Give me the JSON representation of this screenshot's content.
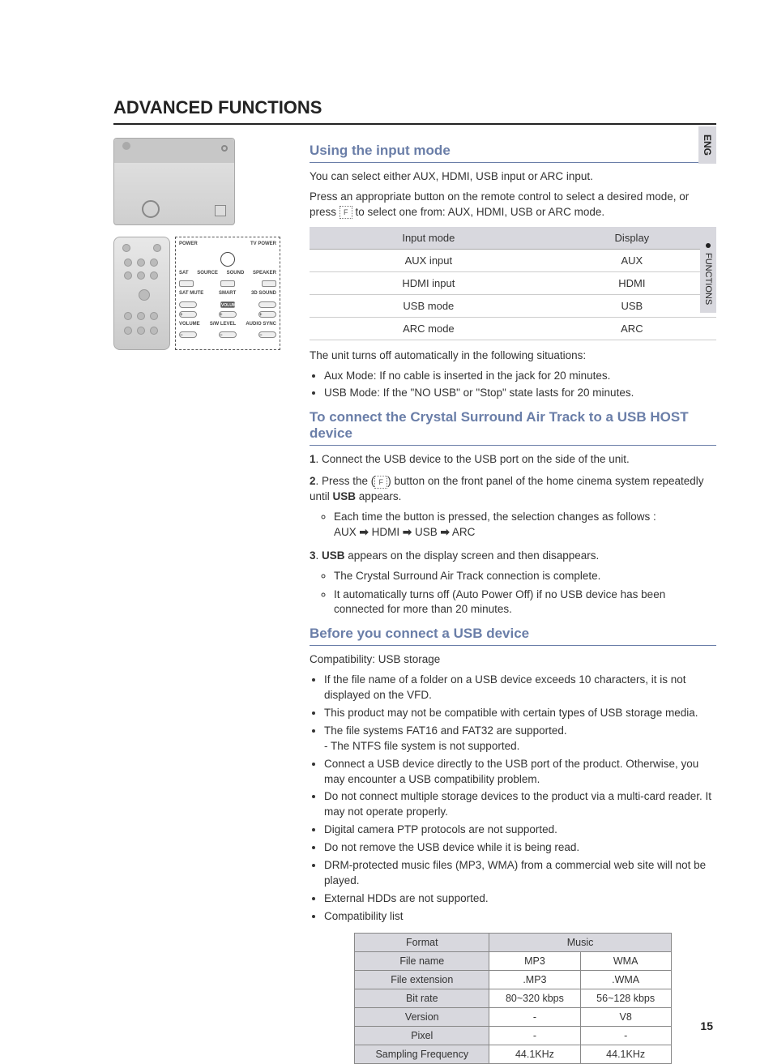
{
  "page": {
    "main_title": "ADVANCED FUNCTIONS",
    "lang_tab": "ENG",
    "section_tab": "FUNCTIONS",
    "page_number": "15"
  },
  "remote_labels": {
    "power": "POWER",
    "tvpower": "TV POWER",
    "sat": "SAT",
    "source": "SOURCE",
    "sound": "SOUND",
    "speaker": "SPEAKER",
    "satmute": "SAT MUTE",
    "smart": "SMART",
    "volume_center": "VOLUME",
    "sound3d": "3D SOUND",
    "volume": "VOLUME",
    "swlevel": "S/W LEVEL",
    "audiosync": "AUDIO SYNC"
  },
  "input_mode": {
    "heading": "Using the input mode",
    "para1": "You can select either AUX, HDMI, USB input or ARC input.",
    "para2a": "Press an appropriate button on the remote control to select a desired mode, or press ",
    "para2b": " to select one from: AUX, HDMI, USB or ARC mode.",
    "table": {
      "head": [
        "Input mode",
        "Display"
      ],
      "rows": [
        [
          "AUX input",
          "AUX"
        ],
        [
          "HDMI input",
          "HDMI"
        ],
        [
          "USB mode",
          "USB"
        ],
        [
          "ARC mode",
          "ARC"
        ]
      ]
    },
    "after1": "The unit turns off automatically in the following situations:",
    "bullets": [
      "Aux Mode: If no cable is inserted in the jack for 20 minutes.",
      "USB Mode: If the \"NO USB\" or \"Stop\" state lasts for 20 minutes."
    ]
  },
  "usb_host": {
    "heading": "To connect the Crystal Surround Air Track to a USB HOST device",
    "step1_num": "1",
    "step1": ". Connect the USB device to the USB port on the side of the unit.",
    "step2_num": "2",
    "step2a": ". Press the (",
    "step2b": ") button on the front panel of the home cinema system repeatedly until ",
    "step2c_bold": "USB",
    "step2d": " appears.",
    "step2_sub": "Each time the button is pressed, the selection changes as follows :",
    "step2_chain": [
      "AUX",
      "HDMI",
      "USB",
      "ARC"
    ],
    "step3_num": "3",
    "step3a_bold": "USB",
    "step3b": " appears on the display screen and then disappears.",
    "step3_subs": [
      "The Crystal Surround Air Track connection is complete.",
      "It automatically turns off (Auto Power Off) if no USB device has been connected for more than 20 minutes."
    ]
  },
  "before_usb": {
    "heading": "Before you connect a USB device",
    "intro": "Compatibility: USB storage",
    "bullets": [
      "If the file name of a folder on a USB device exceeds 10 characters, it is not displayed on the VFD.",
      "This product may not be compatible with certain types of USB storage media.",
      "The file systems FAT16 and FAT32 are supported.",
      "Connect a USB device directly to the USB port of the product. Otherwise, you may encounter a USB compatibility problem.",
      "Do not connect multiple storage devices to the product via a multi-card reader. It may not operate properly.",
      "Digital camera PTP protocols are not supported.",
      "Do not remove the USB device while it is being read.",
      "DRM-protected music files (MP3, WMA) from a commercial web site will not be played.",
      "External HDDs are not supported.",
      "Compatibility list"
    ],
    "ntfs_note": "-  The NTFS file system is not supported.",
    "compat_table": {
      "format": "Format",
      "music": "Music",
      "rows": [
        [
          "File name",
          "MP3",
          "WMA"
        ],
        [
          "File extension",
          ".MP3",
          ".WMA"
        ],
        [
          "Bit rate",
          "80~320 kbps",
          "56~128 kbps"
        ],
        [
          "Version",
          "-",
          "V8"
        ],
        [
          "Pixel",
          "-",
          "-"
        ],
        [
          "Sampling Frequency",
          "44.1KHz",
          "44.1KHz"
        ]
      ]
    }
  }
}
